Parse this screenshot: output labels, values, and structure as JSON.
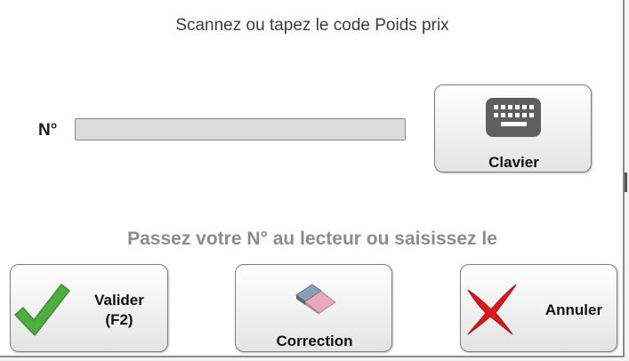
{
  "dialog": {
    "title": "Scannez ou tapez le code Poids prix",
    "number_label": "N°",
    "number_value": "",
    "keyboard_button_label": "Clavier",
    "hint": "Passez votre N° au lecteur ou saisissez le"
  },
  "buttons": {
    "validate_line1": "Valider",
    "validate_line2": "(F2)",
    "correction": "Correction",
    "cancel": "Annuler"
  },
  "icons": {
    "keyboard": "keyboard-icon",
    "validate": "check-icon",
    "correction": "eraser-icon",
    "cancel": "x-icon"
  },
  "colors": {
    "check": "#4caf3f",
    "cancel": "#e0161e",
    "keyboard": "#5f5f5f",
    "hint_text": "#8c8c8c"
  }
}
